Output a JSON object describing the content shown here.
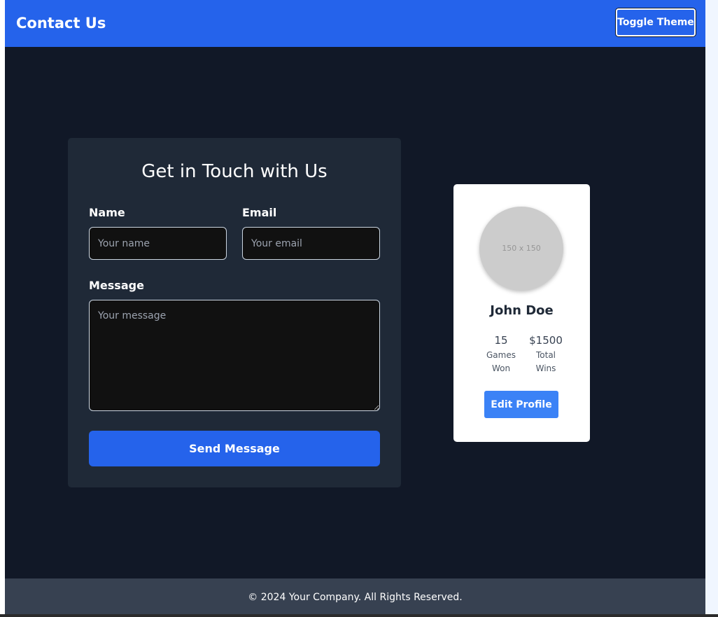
{
  "header": {
    "title": "Contact Us",
    "toggle_theme_label": "Toggle Theme"
  },
  "contact_form": {
    "title": "Get in Touch with Us",
    "name": {
      "label": "Name",
      "placeholder": "Your name",
      "value": ""
    },
    "email": {
      "label": "Email",
      "placeholder": "Your email",
      "value": ""
    },
    "message": {
      "label": "Message",
      "placeholder": "Your message",
      "value": ""
    },
    "submit_label": "Send Message"
  },
  "profile": {
    "avatar_placeholder": "150 x 150",
    "name": "John Doe",
    "stats": [
      {
        "value": "15",
        "label": "Games Won"
      },
      {
        "value": "$1500",
        "label": "Total Wins"
      }
    ],
    "edit_label": "Edit Profile"
  },
  "footer": {
    "text": "© 2024 Your Company. All Rights Reserved."
  },
  "colors": {
    "primary": "#2563eb",
    "page_background": "#111827",
    "card_background": "#1f2937",
    "input_background": "#111111",
    "footer_background": "#374151",
    "edit_button": "#3b82f6",
    "avatar_placeholder": "#cccccc"
  }
}
